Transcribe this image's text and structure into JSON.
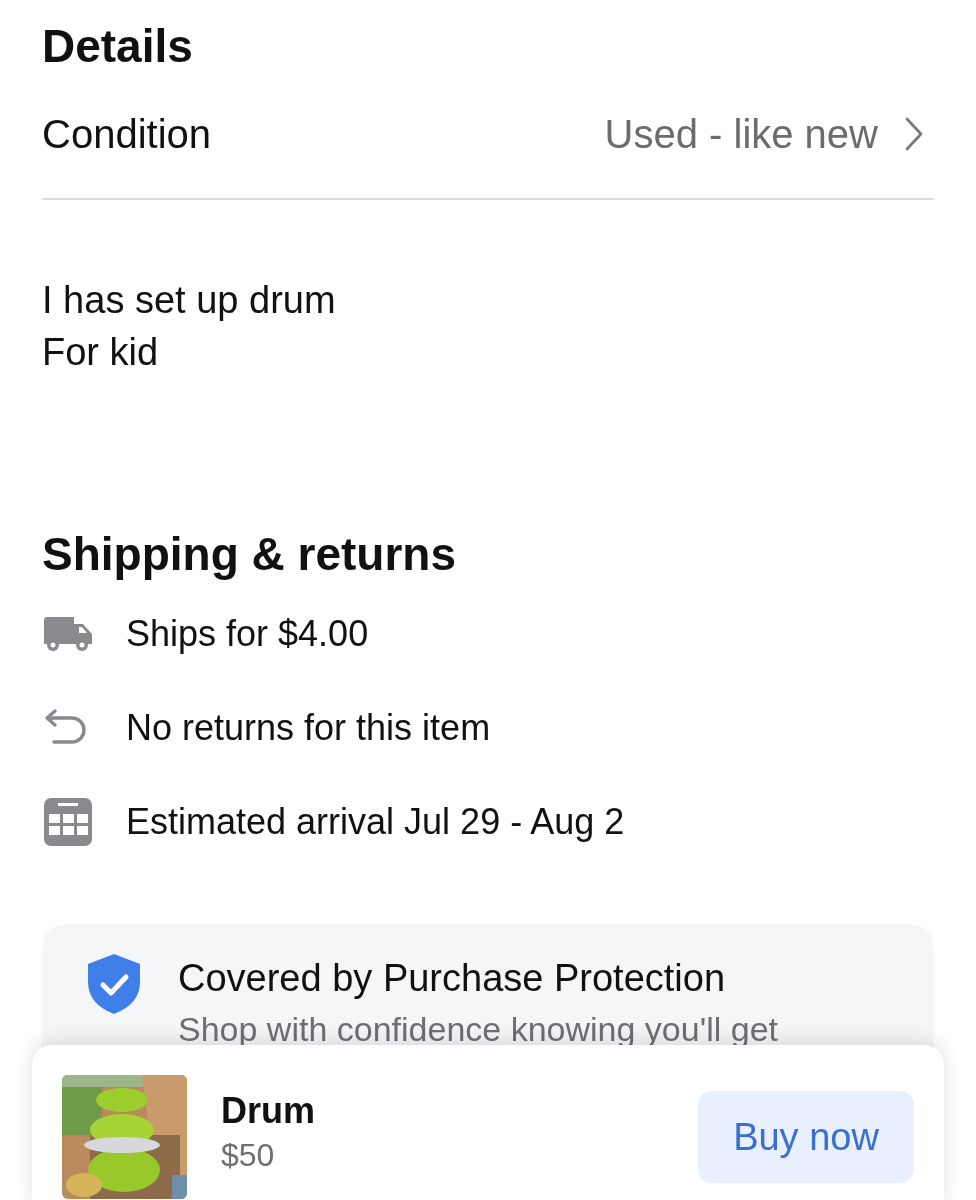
{
  "details": {
    "title": "Details",
    "condition": {
      "label": "Condition",
      "value": "Used - like new"
    },
    "description": [
      "I has set up drum",
      "For kid"
    ]
  },
  "shipping": {
    "title": "Shipping & returns",
    "items": [
      {
        "kind": "truck",
        "text": "Ships for $4.00"
      },
      {
        "kind": "return",
        "text": "No returns for this item"
      },
      {
        "kind": "calendar",
        "text": "Estimated arrival Jul 29 - Aug 2"
      }
    ]
  },
  "protection": {
    "title": "Covered by Purchase Protection",
    "description": "Shop with confidence knowing you'll get"
  },
  "bottom_bar": {
    "title": "Drum",
    "price": "$50",
    "button": "Buy now"
  }
}
